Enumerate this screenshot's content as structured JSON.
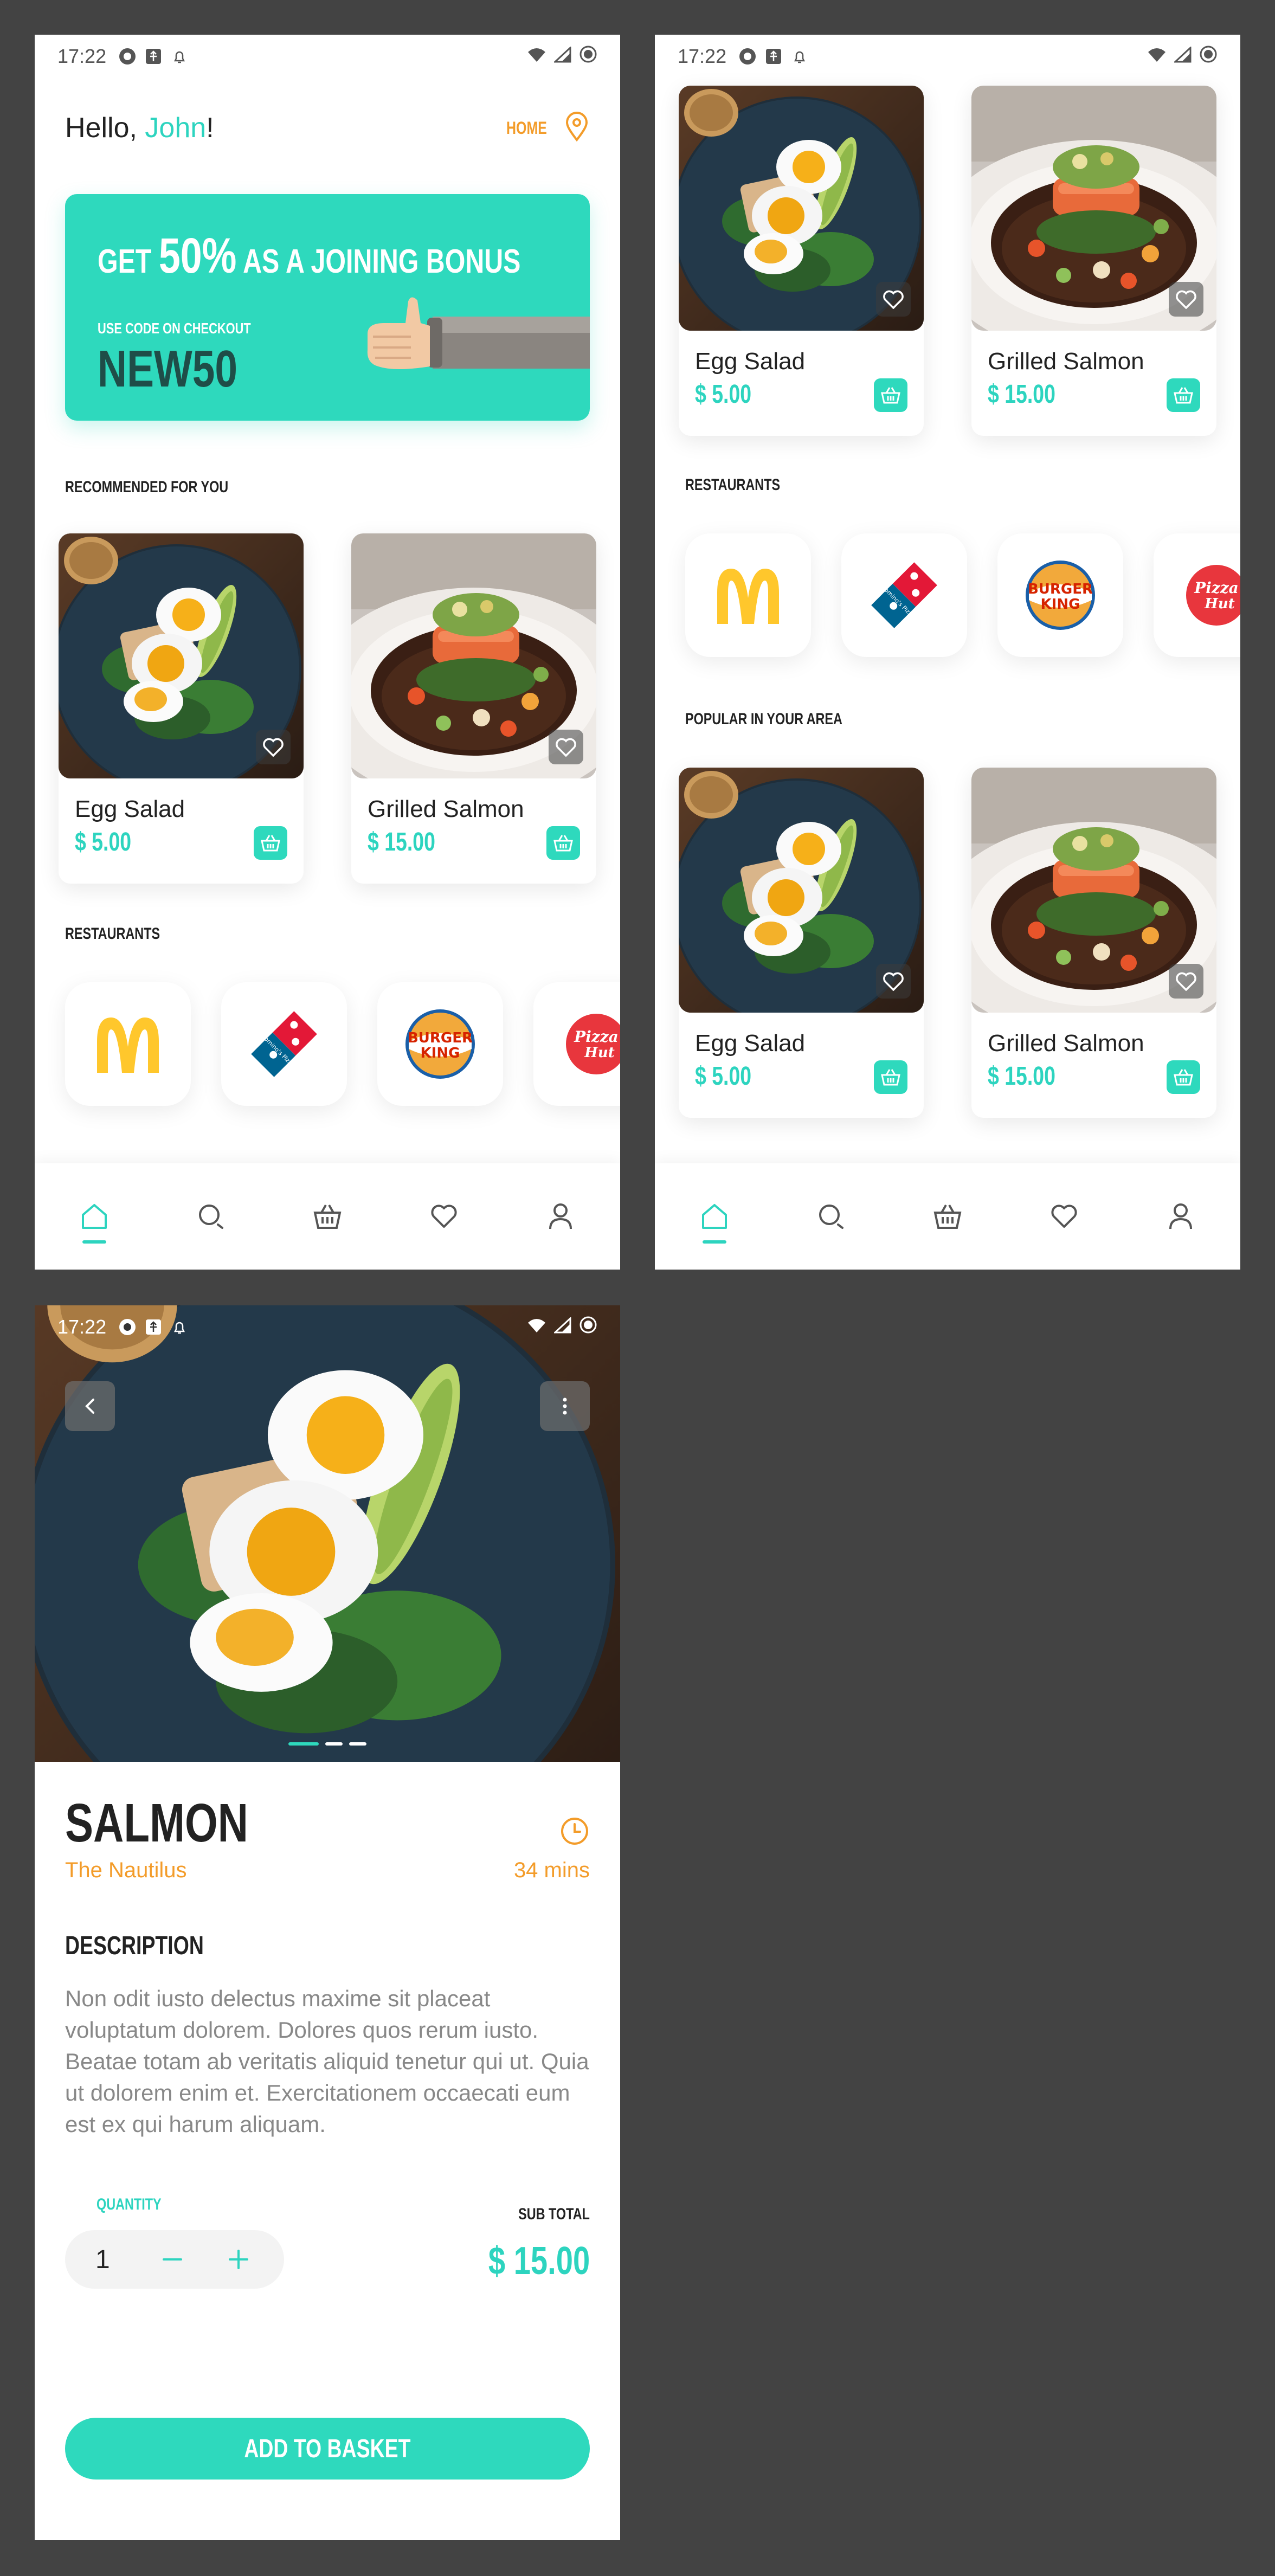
{
  "status": {
    "time": "17:22"
  },
  "home": {
    "greeting_prefix": "Hello, ",
    "user_name": "John",
    "greeting_suffix": "!",
    "location_label": "HOME",
    "promo": {
      "line1_prefix": "GET ",
      "line1_big": "50%",
      "line1_suffix": " AS A JOINING BONUS",
      "line2": "USE CODE ON CHECKOUT",
      "code": "NEW50"
    },
    "section_recommended": "RECOMMENDED FOR YOU",
    "section_restaurants": "RESTAURANTS"
  },
  "home_scrolled": {
    "section_restaurants": "RESTAURANTS",
    "section_popular": "POPULAR IN YOUR AREA"
  },
  "food": [
    {
      "name": "Egg Salad",
      "price": "$ 5.00"
    },
    {
      "name": "Grilled Salmon",
      "price": "$ 15.00"
    }
  ],
  "restaurants": [
    {
      "icon": "mcdonalds-logo"
    },
    {
      "icon": "dominos-logo",
      "text": "Domino's Pizza"
    },
    {
      "icon": "burger-king-logo",
      "text1": "BURGER",
      "text2": "KING"
    },
    {
      "icon": "pizza-hut-logo",
      "text1": "Pizza",
      "text2": "Hut"
    }
  ],
  "nav": [
    "home-icon",
    "search-icon",
    "basket-icon",
    "heart-icon",
    "profile-icon"
  ],
  "detail": {
    "title": "SALMON",
    "restaurant": "The Nautilus",
    "time": "34 mins",
    "description_heading": "DESCRIPTION",
    "description": "Non odit iusto delectus maxime sit placeat voluptatum dolorem. Dolores quos rerum iusto. Beatae totam ab veritatis aliquid tenetur qui ut. Quia ut dolorem enim et. Exercitationem occaecati eum est ex qui harum aliquam.",
    "quantity_label": "QUANTITY",
    "quantity": "1",
    "subtotal_label": "SUB TOTAL",
    "subtotal": "$ 15.00",
    "add_button": "ADD TO BASKET"
  },
  "colors": {
    "accent": "#2ed9bd",
    "orange": "#f39c2a",
    "text": "#222222"
  }
}
